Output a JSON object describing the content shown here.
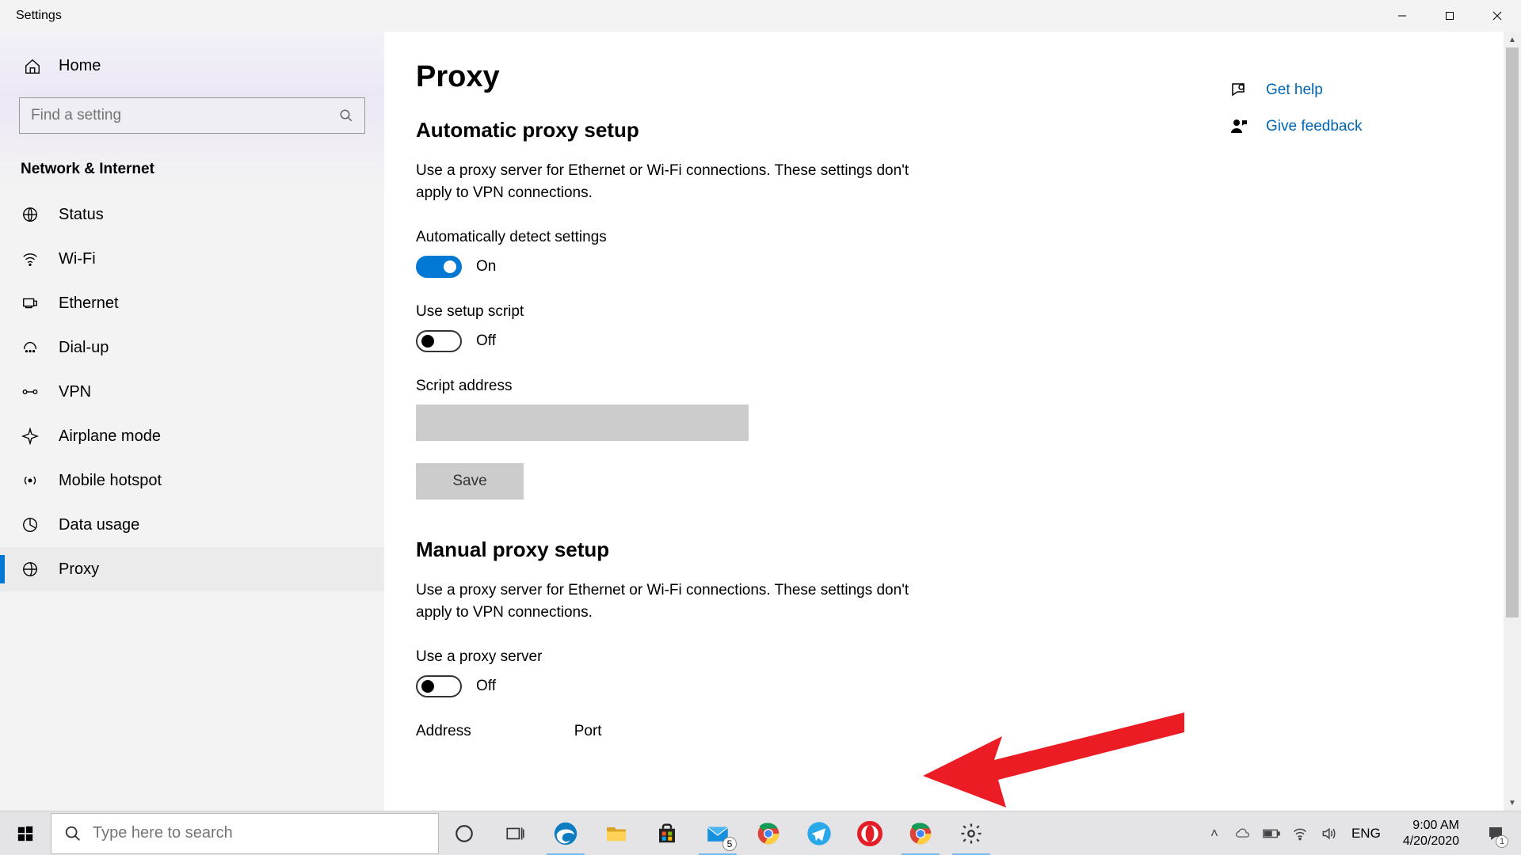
{
  "window": {
    "title": "Settings"
  },
  "sidebar": {
    "home": "Home",
    "search_placeholder": "Find a setting",
    "section": "Network & Internet",
    "items": [
      {
        "label": "Status"
      },
      {
        "label": "Wi-Fi"
      },
      {
        "label": "Ethernet"
      },
      {
        "label": "Dial-up"
      },
      {
        "label": "VPN"
      },
      {
        "label": "Airplane mode"
      },
      {
        "label": "Mobile hotspot"
      },
      {
        "label": "Data usage"
      },
      {
        "label": "Proxy"
      }
    ]
  },
  "page": {
    "title": "Proxy",
    "auto": {
      "heading": "Automatic proxy setup",
      "desc": "Use a proxy server for Ethernet or Wi-Fi connections. These settings don't apply to VPN connections.",
      "detect_label": "Automatically detect settings",
      "detect_state": "On",
      "script_label": "Use setup script",
      "script_state": "Off",
      "script_addr_label": "Script address",
      "script_addr_value": "",
      "save": "Save"
    },
    "manual": {
      "heading": "Manual proxy setup",
      "desc": "Use a proxy server for Ethernet or Wi-Fi connections. These settings don't apply to VPN connections.",
      "use_label": "Use a proxy server",
      "use_state": "Off",
      "address_label": "Address",
      "port_label": "Port"
    }
  },
  "help": {
    "get": "Get help",
    "feedback": "Give feedback"
  },
  "taskbar": {
    "search_placeholder": "Type here to search",
    "mail_badge": "5",
    "lang": "ENG",
    "time": "9:00 AM",
    "date": "4/20/2020",
    "notif_count": "1"
  }
}
